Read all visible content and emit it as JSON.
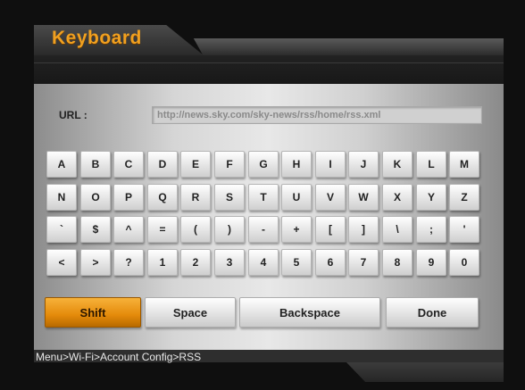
{
  "window": {
    "title": "Keyboard"
  },
  "url": {
    "label": "URL  :",
    "value": "http://news.sky.com/sky-news/rss/home/rss.xml"
  },
  "keyboard": {
    "rows": [
      [
        "A",
        "B",
        "C",
        "D",
        "E",
        "F",
        "G",
        "H",
        "I",
        "J",
        "K",
        "L",
        "M"
      ],
      [
        "N",
        "O",
        "P",
        "Q",
        "R",
        "S",
        "T",
        "U",
        "V",
        "W",
        "X",
        "Y",
        "Z"
      ],
      [
        "`",
        "$",
        "^",
        "=",
        "(",
        ")",
        "-",
        "+",
        "[",
        "]",
        "\\",
        ";",
        "'"
      ],
      [
        "<",
        ">",
        "?",
        "1",
        "2",
        "3",
        "4",
        "5",
        "6",
        "7",
        "8",
        "9",
        "0"
      ]
    ],
    "shift_label": "Shift",
    "space_label": "Space",
    "backspace_label": "Backspace",
    "done_label": "Done"
  },
  "footer": {
    "breadcrumb": "Menu>Wi-Fi>Account Config>RSS"
  },
  "colors": {
    "accent": "#f0a020",
    "shift": "#e48a0a",
    "panel": "#e0e0e0"
  }
}
